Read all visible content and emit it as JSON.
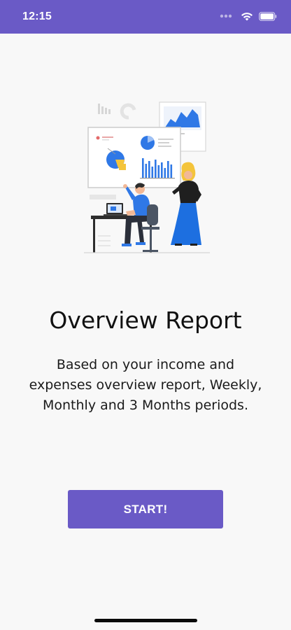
{
  "status_bar": {
    "time": "12:15",
    "background": "#6a5ac6",
    "icons": [
      "signal-dots-icon",
      "wifi-icon",
      "battery-icon"
    ]
  },
  "illustration": {
    "semantic": "analytics-presentation-illustration",
    "accent_color": "#2f78e6",
    "secondary_color": "#f4c43b"
  },
  "onboarding": {
    "title": "Overview Report",
    "description": "Based on your income and expenses overview report, Weekly, Monthly and 3 Months periods."
  },
  "actions": {
    "start_label": "START!",
    "button_color": "#6a5ac6"
  }
}
